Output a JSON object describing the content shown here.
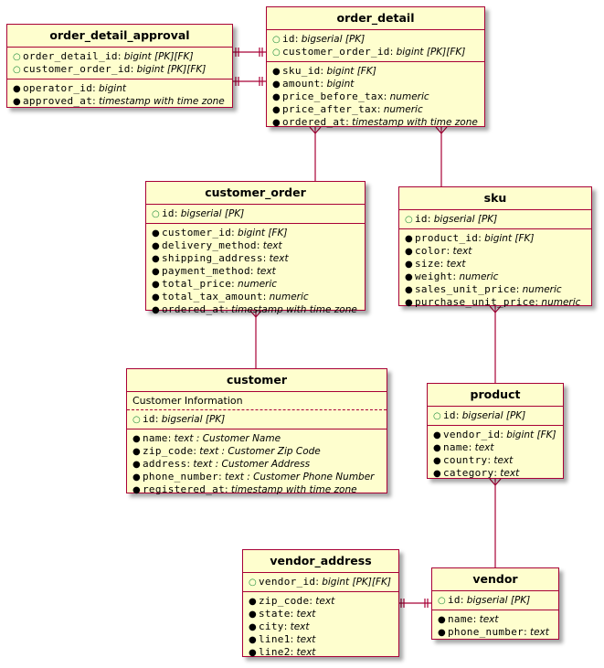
{
  "diagram": {
    "type": "entity-relationship",
    "line_color": "#A80036",
    "entity_fill": "#FEFECE",
    "pk_marker_color": "#1E8C3C"
  },
  "entities": {
    "order_detail_approval": {
      "name": "order_detail_approval",
      "keys": [
        {
          "marker": "○",
          "name": "order_detail_id",
          "type": "bigint [PK][FK]"
        },
        {
          "marker": "○",
          "name": "customer_order_id",
          "type": "bigint [PK][FK]"
        }
      ],
      "fields": [
        {
          "marker": "●",
          "name": "operator_id",
          "type": "bigint"
        },
        {
          "marker": "●",
          "name": "approved_at",
          "type": "timestamp with time zone"
        }
      ]
    },
    "order_detail": {
      "name": "order_detail",
      "keys": [
        {
          "marker": "○",
          "name": "id",
          "type": "bigserial [PK]"
        },
        {
          "marker": "○",
          "name": "customer_order_id",
          "type": "bigint [PK][FK]"
        }
      ],
      "fields": [
        {
          "marker": "●",
          "name": "sku_id",
          "type": "bigint [FK]"
        },
        {
          "marker": "●",
          "name": "amount",
          "type": "bigint"
        },
        {
          "marker": "●",
          "name": "price_before_tax",
          "type": "numeric"
        },
        {
          "marker": "●",
          "name": "price_after_tax",
          "type": "numeric"
        },
        {
          "marker": "●",
          "name": "ordered_at",
          "type": "timestamp with time zone"
        }
      ]
    },
    "customer_order": {
      "name": "customer_order",
      "keys": [
        {
          "marker": "○",
          "name": "id",
          "type": "bigserial [PK]"
        }
      ],
      "fields": [
        {
          "marker": "●",
          "name": "customer_id",
          "type": "bigint [FK]"
        },
        {
          "marker": "●",
          "name": "delivery_method",
          "type": "text"
        },
        {
          "marker": "●",
          "name": "shipping_address",
          "type": "text"
        },
        {
          "marker": "●",
          "name": "payment_method",
          "type": "text"
        },
        {
          "marker": "●",
          "name": "total_price",
          "type": "numeric"
        },
        {
          "marker": "●",
          "name": "total_tax_amount",
          "type": "numeric"
        },
        {
          "marker": "●",
          "name": "ordered_at",
          "type": "timestamp with time zone"
        }
      ]
    },
    "sku": {
      "name": "sku",
      "keys": [
        {
          "marker": "○",
          "name": "id",
          "type": "bigserial [PK]"
        }
      ],
      "fields": [
        {
          "marker": "●",
          "name": "product_id",
          "type": "bigint [FK]"
        },
        {
          "marker": "●",
          "name": "color",
          "type": "text"
        },
        {
          "marker": "●",
          "name": "size",
          "type": "text"
        },
        {
          "marker": "●",
          "name": "weight",
          "type": "numeric"
        },
        {
          "marker": "●",
          "name": "sales_unit_price",
          "type": "numeric"
        },
        {
          "marker": "●",
          "name": "purchase_unit_price",
          "type": "numeric"
        }
      ]
    },
    "customer": {
      "name": "customer",
      "description": "Customer Information",
      "keys": [
        {
          "marker": "○",
          "name": "id",
          "type": "bigserial [PK]"
        }
      ],
      "fields": [
        {
          "marker": "●",
          "name": "name",
          "type": "text",
          "comment": " : Customer Name"
        },
        {
          "marker": "●",
          "name": "zip_code",
          "type": "text",
          "comment": " : Customer Zip Code"
        },
        {
          "marker": "●",
          "name": "address",
          "type": "text",
          "comment": " : Customer Address"
        },
        {
          "marker": "●",
          "name": "phone_number",
          "type": "text",
          "comment": " : Customer Phone Number"
        },
        {
          "marker": "●",
          "name": "registered_at",
          "type": "timestamp with time zone"
        }
      ]
    },
    "product": {
      "name": "product",
      "keys": [
        {
          "marker": "○",
          "name": "id",
          "type": "bigserial [PK]"
        }
      ],
      "fields": [
        {
          "marker": "●",
          "name": "vendor_id",
          "type": "bigint [FK]"
        },
        {
          "marker": "●",
          "name": "name",
          "type": "text"
        },
        {
          "marker": "●",
          "name": "country",
          "type": "text"
        },
        {
          "marker": "●",
          "name": "category",
          "type": "text"
        }
      ]
    },
    "vendor_address": {
      "name": "vendor_address",
      "keys": [
        {
          "marker": "○",
          "name": "vendor_id",
          "type": "bigint [PK][FK]"
        }
      ],
      "fields": [
        {
          "marker": "●",
          "name": "zip_code",
          "type": "text"
        },
        {
          "marker": "●",
          "name": "state",
          "type": "text"
        },
        {
          "marker": "●",
          "name": "city",
          "type": "text"
        },
        {
          "marker": "●",
          "name": "line1",
          "type": "text"
        },
        {
          "marker": "●",
          "name": "line2",
          "type": "text"
        }
      ]
    },
    "vendor": {
      "name": "vendor",
      "keys": [
        {
          "marker": "○",
          "name": "id",
          "type": "bigserial [PK]"
        }
      ],
      "fields": [
        {
          "marker": "●",
          "name": "name",
          "type": "text"
        },
        {
          "marker": "●",
          "name": "phone_number",
          "type": "text"
        }
      ]
    }
  },
  "relationships": [
    {
      "from": "order_detail_approval",
      "to": "order_detail",
      "from_cardinality": "exactly-one",
      "to_cardinality": "exactly-one"
    },
    {
      "from": "order_detail_approval",
      "to": "order_detail",
      "from_cardinality": "exactly-one",
      "to_cardinality": "exactly-one"
    },
    {
      "from": "order_detail",
      "to": "customer_order",
      "from_cardinality": "many",
      "to_cardinality": "one"
    },
    {
      "from": "order_detail",
      "to": "sku",
      "from_cardinality": "many",
      "to_cardinality": "one"
    },
    {
      "from": "customer_order",
      "to": "customer",
      "from_cardinality": "many",
      "to_cardinality": "one"
    },
    {
      "from": "sku",
      "to": "product",
      "from_cardinality": "many",
      "to_cardinality": "one"
    },
    {
      "from": "product",
      "to": "vendor",
      "from_cardinality": "many",
      "to_cardinality": "one"
    },
    {
      "from": "vendor_address",
      "to": "vendor",
      "from_cardinality": "exactly-one",
      "to_cardinality": "exactly-one"
    }
  ]
}
